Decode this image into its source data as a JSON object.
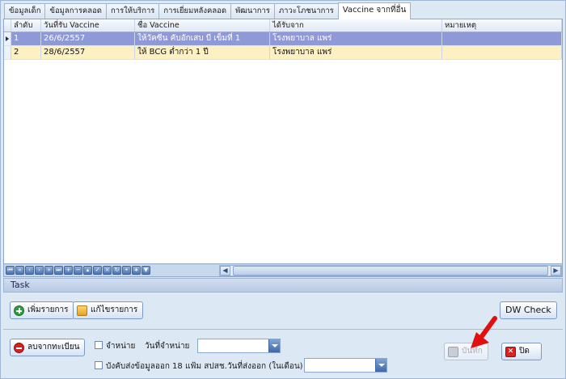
{
  "tabs": [
    {
      "label": "ข้อมูลเด็ก"
    },
    {
      "label": "ข้อมูลการคลอด"
    },
    {
      "label": "การให้บริการ"
    },
    {
      "label": "การเยี่ยมหลังคลอด"
    },
    {
      "label": "พัฒนาการ"
    },
    {
      "label": "ภาวะโภชนาการ"
    },
    {
      "label": "Vaccine จากที่อื่น"
    }
  ],
  "active_tab": "Vaccine จากที่อื่น",
  "grid": {
    "columns": [
      "ลำดับ",
      "วันที่รับ Vaccine",
      "ชื่อ Vaccine",
      "ได้รับจาก",
      "หมายเหตุ"
    ],
    "rows": [
      {
        "no": "1",
        "date": "26/6/2557",
        "vaccine": "ให้วัคซีน คับอักเสบ บี เข็มที่ 1",
        "from": "โรงพยาบาล แพร่",
        "note": ""
      },
      {
        "no": "2",
        "date": "28/6/2557",
        "vaccine": "ให้ BCG ต่ำกว่า 1 ปี",
        "from": "โรงพยาบาล แพร่",
        "note": ""
      }
    ],
    "navigator_buttons": [
      "first",
      "prev-page",
      "prev",
      "next",
      "next-page",
      "last",
      "append",
      "delete",
      "edit",
      "end-edit",
      "cancel-edit",
      "refresh",
      "bookmark",
      "goto-bookmark",
      "filter"
    ]
  },
  "task": {
    "title": "Task",
    "add_label": "เพิ่มรายการ",
    "edit_label": "แก้ไขรายการ",
    "dw_check_label": "DW Check"
  },
  "bottom": {
    "remove_label": "ลบจากทะเบียน",
    "discharge_label": "จำหน่าย",
    "discharge_date_label": "วันที่จำหน่าย",
    "force_send_label": "บังคับส่งข้อมูลออก 18 แฟ้ม สปสช.",
    "send_date_label": "วันที่ส่งออก (ในเดือน)",
    "save_label": "บันทึก",
    "close_label": "ปิด"
  },
  "colors": {
    "selected_row": "#8f99d8",
    "alt_row": "#fdf1c4",
    "annotation_arrow": "#e01010"
  }
}
